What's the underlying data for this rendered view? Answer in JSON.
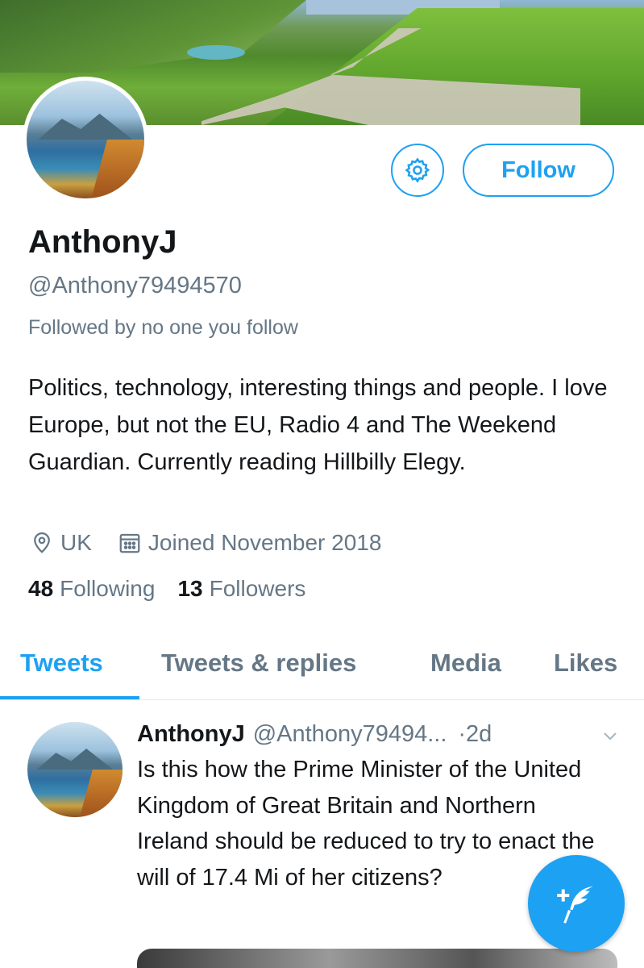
{
  "profile": {
    "name": "AnthonyJ",
    "handle": "@Anthony79494570",
    "followed_by": "Followed by no one you follow",
    "bio": "Politics, technology, interesting things and people. I love Europe, but not the EU, Radio 4 and The Weekend Guardian. Currently reading Hillbilly Elegy.",
    "location": "UK",
    "joined": "Joined November 2018",
    "following_count": "48",
    "following_label": "Following",
    "followers_count": "13",
    "followers_label": "Followers"
  },
  "actions": {
    "follow_label": "Follow",
    "settings_icon": "gear-icon",
    "compose_icon": "compose-feather-icon"
  },
  "tabs": [
    {
      "label": "Tweets",
      "active": true
    },
    {
      "label": "Tweets & replies",
      "active": false
    },
    {
      "label": "Media",
      "active": false
    },
    {
      "label": "Likes",
      "active": false
    }
  ],
  "tweet": {
    "name": "AnthonyJ",
    "handle": "@Anthony79494...",
    "time": "·2d",
    "text": "Is this how the Prime Minister of the United Kingdom of Great Britain and Northern Ireland should be reduced to try to enact the will of 17.4 Mi of her citizens?"
  },
  "colors": {
    "accent": "#1da1f2",
    "text": "#14171a",
    "secondary_text": "#657786",
    "divider": "#e1e8ed"
  }
}
